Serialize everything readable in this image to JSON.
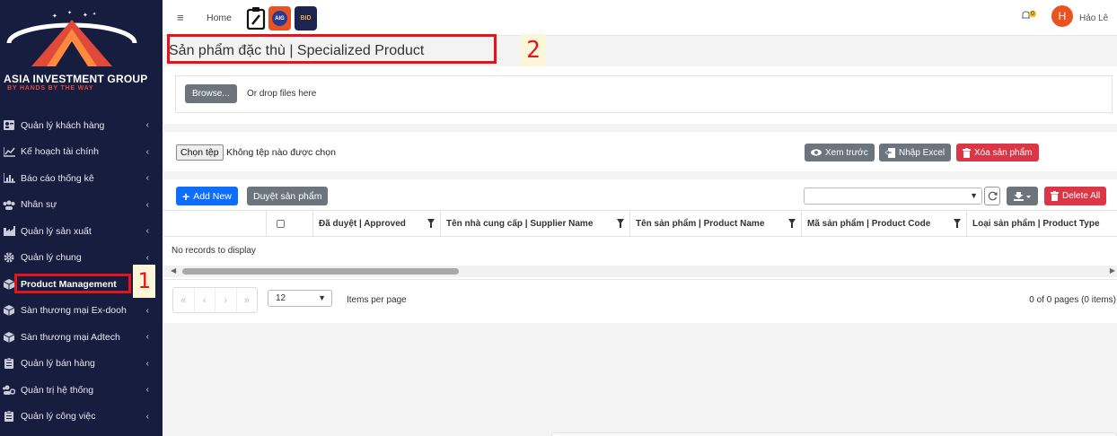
{
  "brand": {
    "name": "ASIA INVESTMENT GROUP",
    "tagline": "BY HANDS BY THE WAY"
  },
  "sidebar": {
    "items": [
      {
        "label": "Quản lý khách hàng",
        "icon": "user-card-icon"
      },
      {
        "label": "Kế hoạch tài chính",
        "icon": "line-chart-icon"
      },
      {
        "label": "Báo cáo thống kê",
        "icon": "bar-chart-icon"
      },
      {
        "label": "Nhân sự",
        "icon": "users-icon"
      },
      {
        "label": "Quản lý sản xuất",
        "icon": "industry-icon"
      },
      {
        "label": "Quản lý chung",
        "icon": "gear-icon"
      },
      {
        "label": "Product Management",
        "icon": "box-icon"
      },
      {
        "label": "Sàn thương mại Ex-dooh",
        "icon": "box-icon"
      },
      {
        "label": "Sàn thương mại Adtech",
        "icon": "box-icon"
      },
      {
        "label": "Quản lý bán hàng",
        "icon": "clipboard-icon"
      },
      {
        "label": "Quản trị hệ thống",
        "icon": "users-cog-icon"
      },
      {
        "label": "Quản lý công việc",
        "icon": "clipboard-icon"
      }
    ],
    "active_index": 6
  },
  "annotations": {
    "marker_1": "1",
    "marker_2": "2"
  },
  "topbar": {
    "home": "Home",
    "app2_label": "AIG",
    "app3_label": "BID",
    "notification_count": "0",
    "avatar_letter": "H",
    "user_name": "Hảo Lê"
  },
  "page": {
    "title": "Sản phẩm đặc thù | Specialized Product"
  },
  "upload": {
    "browse": "Browse...",
    "drop_text": "Or drop files here"
  },
  "file_input": {
    "button": "Chọn tệp",
    "status": "Không tệp nào được chọn"
  },
  "actions": {
    "preview": "Xem trước",
    "import_excel": "Nhập Excel",
    "delete_products": "Xóa sản phẩm",
    "add_new": "Add New",
    "approve_products": "Duyệt sản phẩm",
    "delete_all": "Delete All"
  },
  "grid": {
    "columns": [
      "Đã duyệt | Approved",
      "Tên nhà cung cấp | Supplier Name",
      "Tên sản phẩm | Product Name",
      "Mã sản phẩm | Product Code",
      "Loại sản phẩm | Product Type"
    ],
    "empty_message": "No records to display"
  },
  "pager": {
    "first": "«",
    "prev": "‹",
    "next": "›",
    "last": "»",
    "page_size": "12",
    "items_per_page_label": "Items per page",
    "info": "0 of 0 pages (0 items)"
  },
  "colors": {
    "sidebar_bg": "#171d3f",
    "accent_blue": "#0d6efd",
    "danger_red": "#dc3545",
    "secondary_gray": "#6c757d",
    "highlight_red": "#e3141b",
    "avatar_orange": "#e8531f"
  }
}
